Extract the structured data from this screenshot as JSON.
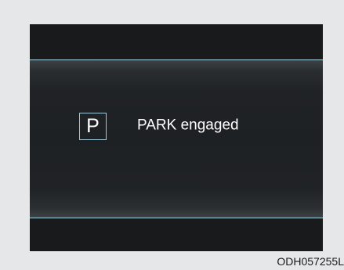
{
  "display": {
    "gear_icon_letter": "P",
    "message": "PARK engaged"
  },
  "figure": {
    "code": "ODH057255L"
  },
  "colors": {
    "page_background": "#e6e7e8",
    "screen_background": "#181a1c",
    "accent_line": "#a9d2e3",
    "text": "#ffffff"
  }
}
